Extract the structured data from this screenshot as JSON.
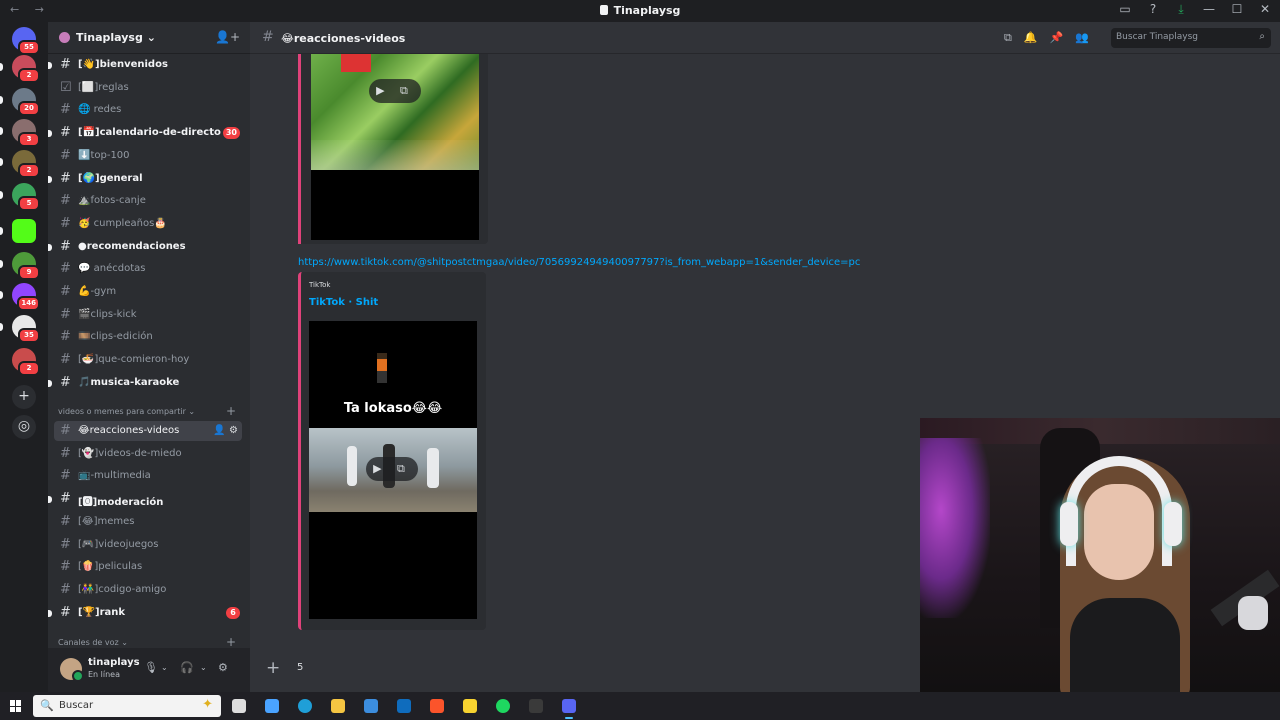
{
  "window": {
    "title": "Tinaplaysg",
    "back": "←",
    "forward": "→",
    "icons": [
      "inbox-icon",
      "help-icon",
      "download-icon",
      "minimize-icon",
      "maximize-icon",
      "close-icon"
    ],
    "icon_glyphs": [
      "▭",
      "?",
      "⤓",
      "—",
      "☐",
      "✕"
    ]
  },
  "guilds": [
    {
      "name": "direct-messages",
      "color": "#5865f2",
      "badge": "55"
    },
    {
      "name": "guild-1",
      "color": "#c94c5c",
      "badge": "2"
    },
    {
      "name": "guild-2",
      "color": "#6c7a89",
      "badge": "20"
    },
    {
      "name": "guild-3",
      "color": "#8a6e6e",
      "badge": "3"
    },
    {
      "name": "guild-4",
      "color": "#7a6a3a",
      "badge": "2"
    },
    {
      "name": "guild-5",
      "color": "#3ba55c",
      "badge": "5"
    },
    {
      "name": "guild-kick",
      "color": "#53fc18",
      "badge": ""
    },
    {
      "name": "guild-mario",
      "color": "#4e9a3a",
      "badge": "9"
    },
    {
      "name": "guild-twitch",
      "color": "#9146ff",
      "badge": "146"
    },
    {
      "name": "guild-8",
      "color": "#e8e8e8",
      "badge": "35"
    },
    {
      "name": "guild-tinaplaysg",
      "color": "#c94c4c",
      "badge": "2"
    }
  ],
  "server": {
    "name": "Tinaplaysg",
    "chevron": "⌄"
  },
  "channels": [
    {
      "name": "[👋]bienvenidos",
      "icon": "#",
      "unread": true,
      "mention": ""
    },
    {
      "name": "[⬜]reglas",
      "icon": "☑",
      "unread": false,
      "mention": ""
    },
    {
      "name": "🌐 redes",
      "icon": "#",
      "unread": false,
      "mention": ""
    },
    {
      "name": "[📅]calendario-de-directo",
      "icon": "#",
      "unread": true,
      "mention": "30"
    },
    {
      "name": "⬇️top-100",
      "icon": "#",
      "unread": false,
      "mention": ""
    },
    {
      "name": "[🌍]general",
      "icon": "#",
      "unread": true,
      "mention": ""
    },
    {
      "name": "⛰️fotos-canje",
      "icon": "#",
      "unread": false,
      "mention": ""
    },
    {
      "name": "🥳 cumpleaños🎂",
      "icon": "#",
      "unread": false,
      "mention": ""
    },
    {
      "name": "●recomendaciones",
      "icon": "#",
      "unread": true,
      "mention": ""
    },
    {
      "name": "💬 anécdotas",
      "icon": "#",
      "unread": false,
      "mention": ""
    },
    {
      "name": "💪-gym",
      "icon": "#",
      "unread": false,
      "mention": ""
    },
    {
      "name": "🎬clips-kick",
      "icon": "#",
      "unread": false,
      "mention": ""
    },
    {
      "name": "🎞️clips-edición",
      "icon": "#",
      "unread": false,
      "mention": ""
    },
    {
      "name": "[🍜]que-comieron-hoy",
      "icon": "#",
      "unread": false,
      "mention": ""
    },
    {
      "name": "🎵musica-karaoke",
      "icon": "#",
      "unread": true,
      "mention": ""
    }
  ],
  "category1": {
    "label": "videos o memes para compartir",
    "chevron": "⌄",
    "plus": "+"
  },
  "channels2": [
    {
      "name": "😂reacciones-videos",
      "icon": "#",
      "unread": false,
      "active": true,
      "mention": ""
    },
    {
      "name": "[👻]videos-de-miedo",
      "icon": "#",
      "unread": false,
      "mention": ""
    },
    {
      "name": "📺-multimedia",
      "icon": "#",
      "unread": false,
      "mention": ""
    },
    {
      "name": "[🅾]moderación",
      "icon": "#",
      "unread": true,
      "mention": ""
    },
    {
      "name": "[😂]memes",
      "icon": "#",
      "unread": false,
      "mention": ""
    },
    {
      "name": "[🎮]videojuegos",
      "icon": "#",
      "unread": false,
      "mention": ""
    },
    {
      "name": "[🍿]peliculas",
      "icon": "#",
      "unread": false,
      "mention": ""
    },
    {
      "name": "[👫]codigo-amigo",
      "icon": "#",
      "unread": false,
      "mention": ""
    },
    {
      "name": "[🏆]rank",
      "icon": "#",
      "unread": true,
      "mention": "6"
    }
  ],
  "category2": {
    "label": "Canales de voz",
    "chevron": "⌄",
    "plus": "+"
  },
  "user": {
    "name": "tinaplays",
    "status": "En línea",
    "mic": "🎙",
    "headset": "🎧",
    "settings": "⚙",
    "chevron": "⌄"
  },
  "header": {
    "channel": "😂reacciones-videos",
    "search_placeholder": "Buscar Tinaplaysg",
    "search_icon": "⌕",
    "icons": [
      "threads-icon",
      "bell-icon",
      "pin-icon",
      "members-icon"
    ],
    "icon_glyphs": [
      "⧉",
      "🔔",
      "📌",
      "👥"
    ]
  },
  "messages": {
    "play_glyph": "▶ ⧉",
    "link": "https://www.tiktok.com/@shitpostctmgaa/video/7056992494940097797?is_from_webapp=1&sender_device=pc",
    "embed": {
      "provider": "TikTok",
      "title": "TikTok · Shit",
      "caption": "Ta lokaso😂😂"
    }
  },
  "composer": {
    "plus": "+",
    "text": "5"
  },
  "taskbar": {
    "search": "Buscar",
    "search_icon": "🔍",
    "spark": "✦",
    "apps": [
      {
        "name": "task-view-icon",
        "color": "#dddddd"
      },
      {
        "name": "copilot-icon",
        "color": "#4aa3ff"
      },
      {
        "name": "edge-icon",
        "color": "#1f9fd8"
      },
      {
        "name": "file-explorer-icon",
        "color": "#f5c542"
      },
      {
        "name": "store-icon",
        "color": "#3c8dde"
      },
      {
        "name": "outlook-icon",
        "color": "#0f6cbd"
      },
      {
        "name": "brave-icon",
        "color": "#fb542b"
      },
      {
        "name": "sticky-notes-icon",
        "color": "#f7d330"
      },
      {
        "name": "spotify-icon",
        "color": "#1ed760"
      },
      {
        "name": "obs-icon",
        "color": "#3a3a3a"
      },
      {
        "name": "discord-icon",
        "color": "#5865f2",
        "active": true
      }
    ]
  }
}
